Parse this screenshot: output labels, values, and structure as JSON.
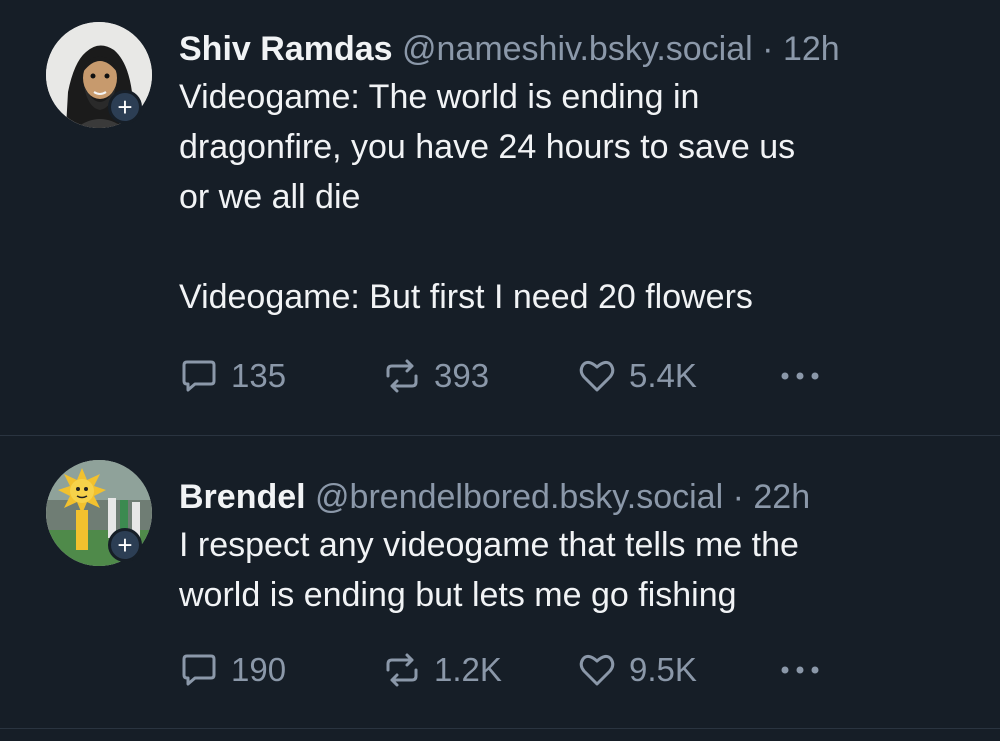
{
  "posts": [
    {
      "author": {
        "display_name": "Shiv Ramdas",
        "handle": "@nameshiv.bsky.social"
      },
      "separator": "·",
      "time": "12h",
      "text": "Videogame: The world is ending in\ndragonfire, you have 24 hours to save us\nor we all die\n\nVideogame: But first I need 20 flowers",
      "counts": {
        "replies": "135",
        "reposts": "393",
        "likes": "5.4K"
      }
    },
    {
      "author": {
        "display_name": "Brendel",
        "handle": "@brendelbored.bsky.social"
      },
      "separator": "·",
      "time": "22h",
      "text": "I respect any videogame that tells me the\nworld is ending but lets me go fishing",
      "counts": {
        "replies": "190",
        "reposts": "1.2K",
        "likes": "9.5K"
      }
    }
  ],
  "follow_badge": "+",
  "icons": {
    "reply": "reply-icon",
    "repost": "repost-icon",
    "like": "heart-icon",
    "more": "more-icon"
  },
  "colors": {
    "background": "#161e27",
    "text": "#f1f3f5",
    "muted": "#8b98a9",
    "divider": "#2a3440"
  }
}
